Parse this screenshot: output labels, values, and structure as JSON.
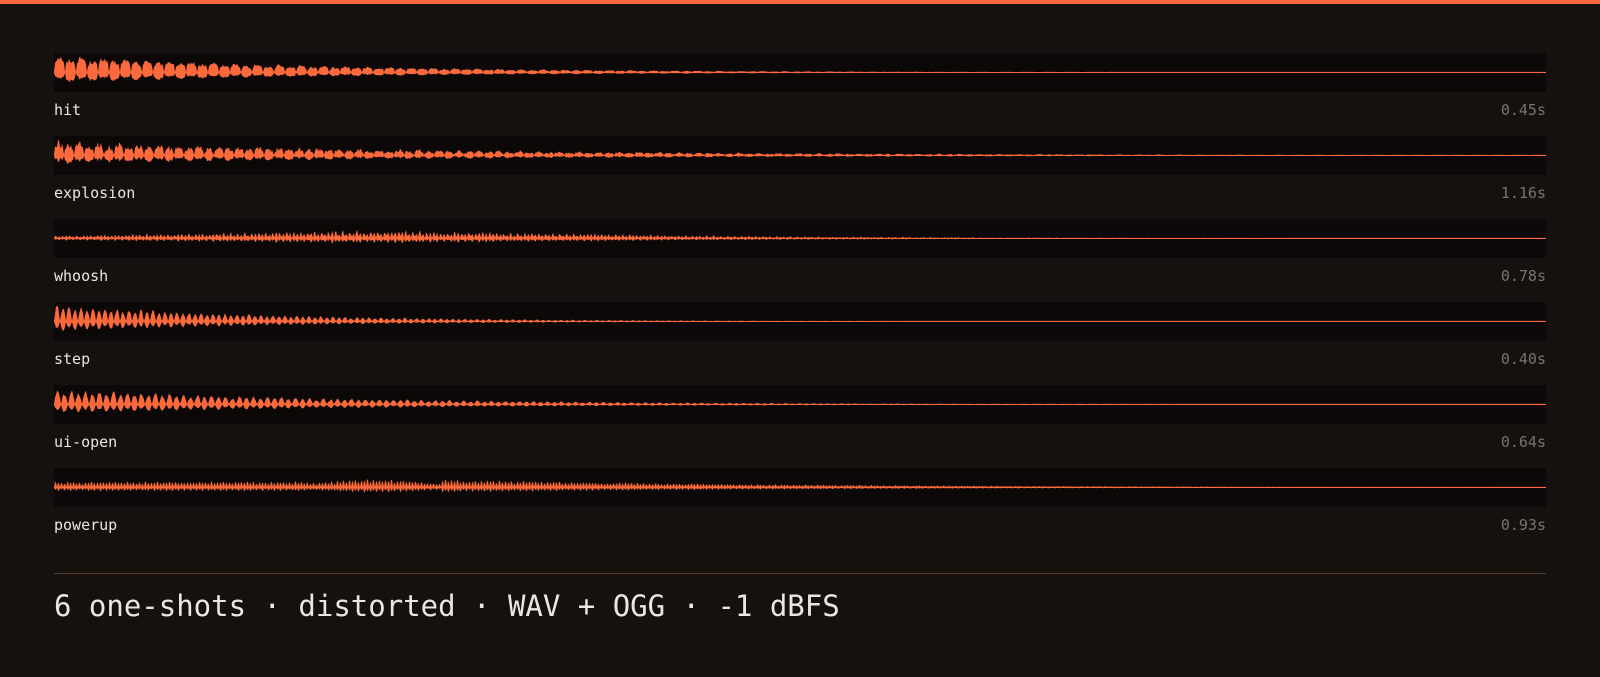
{
  "accent_color": "#ff6a3d",
  "sounds": [
    {
      "name": "hit",
      "duration": "0.45s"
    },
    {
      "name": "explosion",
      "duration": "1.16s"
    },
    {
      "name": "whoosh",
      "duration": "0.78s"
    },
    {
      "name": "step",
      "duration": "0.40s"
    },
    {
      "name": "ui-open",
      "duration": "0.64s"
    },
    {
      "name": "powerup",
      "duration": "0.93s"
    }
  ],
  "footer": "6 one-shots · distorted · WAV + OGG · -1 dBFS"
}
